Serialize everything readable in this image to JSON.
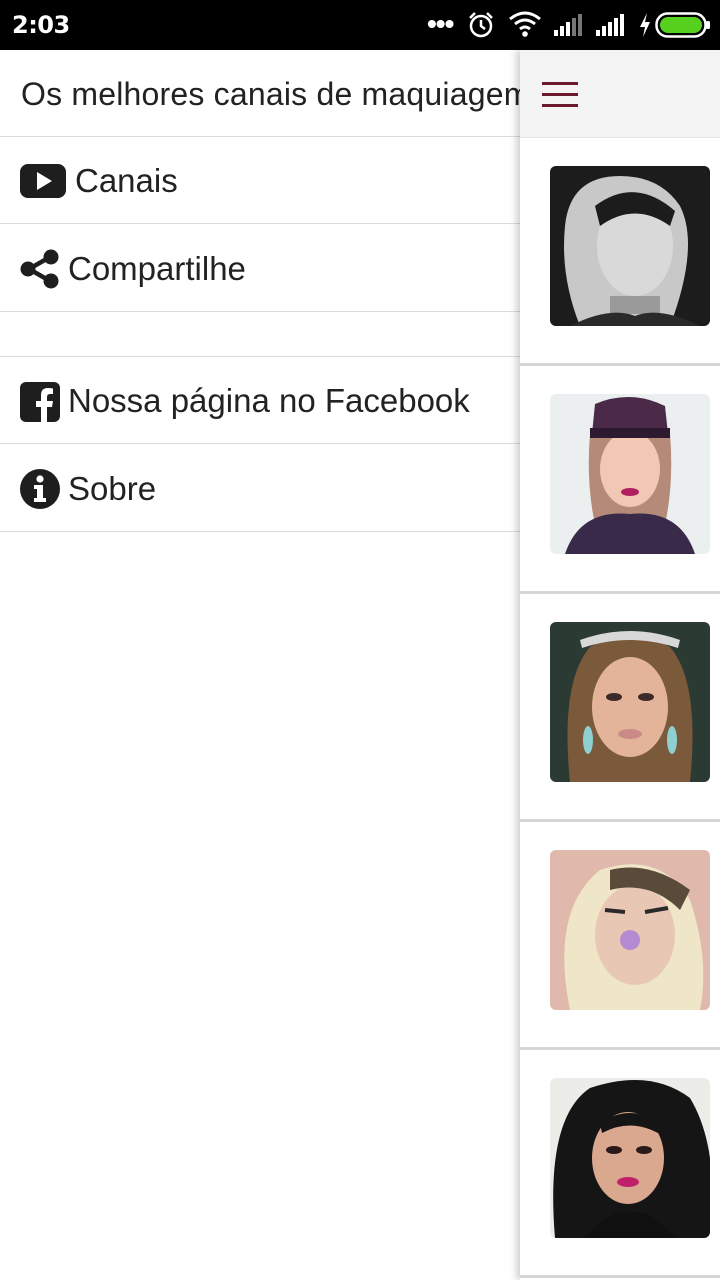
{
  "status_bar": {
    "time": "2:03",
    "dots": "•••",
    "icons": [
      "alarm-icon",
      "wifi-icon",
      "signal-icon",
      "signal-icon",
      "charging-icon",
      "battery-icon"
    ],
    "battery_color": "#56d11e"
  },
  "drawer": {
    "title": "Os melhores canais de maquiagem",
    "items": [
      {
        "label": "Canais",
        "icon": "youtube-icon"
      },
      {
        "label": "Compartilhe",
        "icon": "share-icon"
      },
      {
        "label": "",
        "icon": ""
      },
      {
        "label": "Nossa página no Facebook",
        "icon": "facebook-icon"
      },
      {
        "label": "Sobre",
        "icon": "info-icon"
      }
    ]
  },
  "main": {
    "menu_icon": "hamburger-icon",
    "accent_color": "#6a1a2c",
    "channels": [
      {
        "thumbnail": "channel-avatar-1"
      },
      {
        "thumbnail": "channel-avatar-2"
      },
      {
        "thumbnail": "channel-avatar-3"
      },
      {
        "thumbnail": "channel-avatar-4"
      },
      {
        "thumbnail": "channel-avatar-5"
      }
    ]
  }
}
